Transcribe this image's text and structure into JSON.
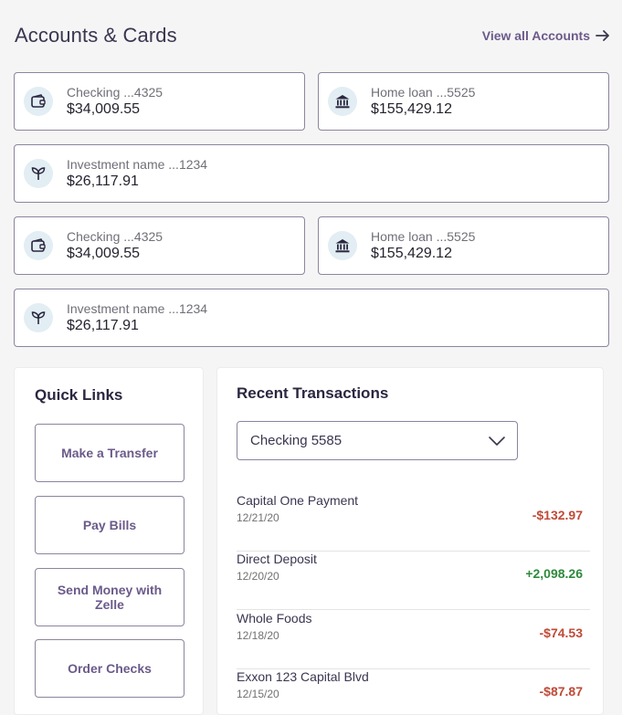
{
  "header": {
    "title": "Accounts & Cards",
    "view_all": "View all Accounts"
  },
  "accounts": [
    {
      "name": "Checking ...4325",
      "balance": "$34,009.55",
      "icon": "wallet-icon"
    },
    {
      "name": "Home loan ...5525",
      "balance": "$155,429.12",
      "icon": "bank-icon"
    },
    {
      "name": "Investment name ...1234",
      "balance": "$26,117.91",
      "icon": "plant-icon"
    },
    {
      "name": "Checking ...4325",
      "balance": "$34,009.55",
      "icon": "wallet-icon"
    },
    {
      "name": "Home loan ...5525",
      "balance": "$155,429.12",
      "icon": "bank-icon"
    },
    {
      "name": "Investment name ...1234",
      "balance": "$26,117.91",
      "icon": "plant-icon"
    }
  ],
  "quick_links": {
    "title": "Quick Links",
    "items": [
      "Make a Transfer",
      "Pay Bills",
      "Send Money with Zelle",
      "Order Checks"
    ]
  },
  "recent": {
    "title": "Recent Transactions",
    "account_select": "Checking 5585",
    "transactions": [
      {
        "description": "Capital One Payment",
        "date": "12/21/20",
        "amount": "-$132.97"
      },
      {
        "description": "Direct Deposit",
        "date": "12/20/20",
        "amount": "+2,098.26"
      },
      {
        "description": "Whole Foods",
        "date": "12/18/20",
        "amount": "-$74.53"
      },
      {
        "description": "Exxon 123 Capital Blvd",
        "date": "12/15/20",
        "amount": "-$87.87"
      }
    ]
  },
  "colors": {
    "accent": "#6b5a8a",
    "negative": "#c04a37",
    "positive": "#2e8a3c",
    "icon_bg": "#e2eef3"
  }
}
